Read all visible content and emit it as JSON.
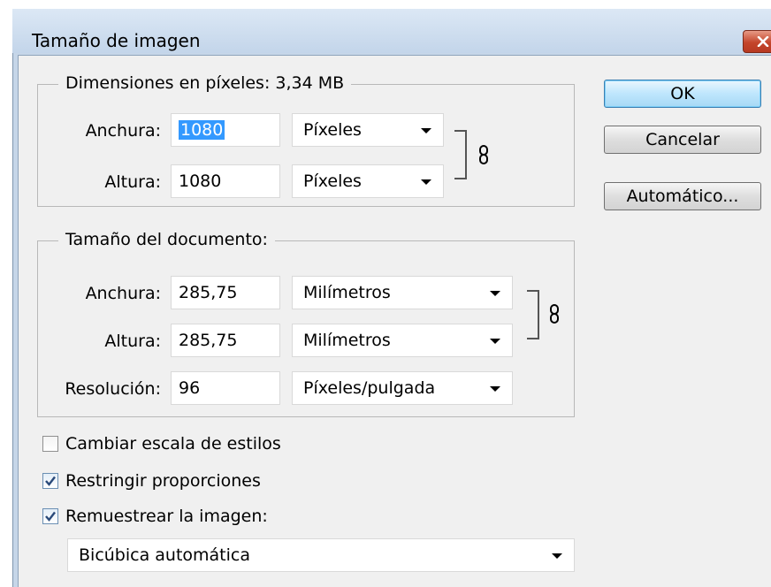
{
  "dialog": {
    "title": "Tamaño de imagen",
    "close_icon": "close-icon"
  },
  "pixel_dimensions": {
    "legend": "Dimensiones en píxeles: 3,34 MB",
    "width_label": "Anchura:",
    "width_value": "1080",
    "width_unit": "Píxeles",
    "height_label": "Altura:",
    "height_value": "1080",
    "height_unit": "Píxeles"
  },
  "document_size": {
    "legend": "Tamaño del documento:",
    "width_label": "Anchura:",
    "width_value": "285,75",
    "width_unit": "Milímetros",
    "height_label": "Altura:",
    "height_value": "285,75",
    "height_unit": "Milímetros",
    "resolution_label": "Resolución:",
    "resolution_value": "96",
    "resolution_unit": "Píxeles/pulgada"
  },
  "buttons": {
    "ok": "OK",
    "cancel": "Cancelar",
    "auto": "Automático..."
  },
  "options": {
    "scale_styles": {
      "label": "Cambiar escala de estilos",
      "checked": false
    },
    "constrain": {
      "label": "Restringir proporciones",
      "checked": true
    },
    "resample": {
      "label": "Remuestrear la imagen:",
      "checked": true
    },
    "resample_method": "Bicúbica automática"
  },
  "colors": {
    "selection": "#3399ff",
    "default_button": "#bee6fd",
    "close_button": "#c4452b"
  }
}
